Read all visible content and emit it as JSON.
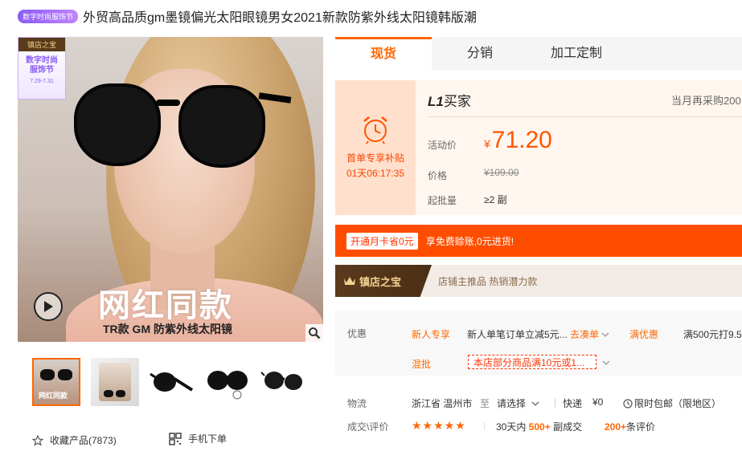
{
  "title": {
    "badge": "数字时尚服饰节",
    "text": "外贸高品质gm墨镜偏光太阳眼镜男女2021新款防紫外线太阳镜韩版潮"
  },
  "gallery": {
    "store_badge_top": "镇店之宝",
    "store_badge_line1": "数字时尚",
    "store_badge_line2": "服饰节",
    "store_badge_date": "7.29-7.31",
    "slogan": "网红同款",
    "caption": "TR款 GM 防紫外线太阳镜",
    "thumb1_caption": "网红同款"
  },
  "actions": {
    "collect_label": "收藏产品(7873)",
    "mobile_label": "手机下单"
  },
  "tabs": [
    {
      "label": "现货",
      "active": true
    },
    {
      "label": "分销",
      "active": false
    },
    {
      "label": "加工定制",
      "active": false
    }
  ],
  "price": {
    "promo_label": "首单专享补贴",
    "promo_timer": "01天06:17:35",
    "buyer_level_prefix": "L1",
    "buyer_level_suffix": "买家",
    "repurchase_note": "当月再采购200",
    "activity_label": "活动价",
    "currency": "¥",
    "activity_value": "71.20",
    "orig_label": "价格",
    "orig_value": "¥109.00",
    "moq_label": "起批量",
    "moq_value": "≥2 副"
  },
  "member": {
    "button": "开通月卡省0元",
    "desc": "享免费赊账,0元进货!"
  },
  "treasure": {
    "tag": "镇店之宝",
    "desc": "店铺主推品  热销潜力款"
  },
  "offers": {
    "label": "优惠",
    "tag1": "新人专享",
    "text1": "新人单笔订单立减5元...",
    "more": "去凑单",
    "tag2": "满优惠",
    "text2": "满500元打9.5",
    "tag3": "混批",
    "mixed": "本店部分商品满10元或1..."
  },
  "logistics": {
    "label": "物流",
    "origin": "浙江省 温州市",
    "to": "至",
    "select": "请选择",
    "express_label": "快递",
    "express_fee": "¥0",
    "limited": "限时包邮（限地区）"
  },
  "reviews": {
    "label": "成交\\评价",
    "stars": "★★★★★",
    "rating": 4.5,
    "days_label": "30天内",
    "sold_count": "500+",
    "sold_unit": "副成交",
    "review_count": "200+",
    "review_unit": "条评价"
  },
  "colors": {
    "accent": "#ff6600",
    "banner": "#ff4d00",
    "treasure_dark": "#5a3a1d"
  }
}
